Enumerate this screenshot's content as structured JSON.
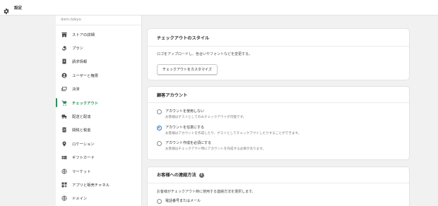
{
  "topbar": {
    "title": "設定",
    "icon": "gear-icon"
  },
  "sidebar": {
    "store_url": "dstn.tokyo",
    "items": [
      {
        "label": "ストアの詳細",
        "icon": "store-icon",
        "active": false
      },
      {
        "label": "プラン",
        "icon": "plan-icon",
        "active": false
      },
      {
        "label": "請求情報",
        "icon": "billing-icon",
        "active": false
      },
      {
        "label": "ユーザーと権限",
        "icon": "user-icon",
        "active": false
      },
      {
        "label": "決済",
        "icon": "payment-icon",
        "active": false
      },
      {
        "label": "チェックアウト",
        "icon": "cart-icon",
        "active": true
      },
      {
        "label": "配送と配達",
        "icon": "truck-icon",
        "active": false
      },
      {
        "label": "関税と税金",
        "icon": "tax-icon",
        "active": false
      },
      {
        "label": "ロケーション",
        "icon": "location-pin-icon",
        "active": false
      },
      {
        "label": "ギフトカード",
        "icon": "gift-card-icon",
        "active": false
      },
      {
        "label": "マーケット",
        "icon": "globe-icon",
        "active": false
      },
      {
        "label": "アプリと販売チャネル",
        "icon": "apps-icon",
        "active": false
      },
      {
        "label": "ドメイン",
        "icon": "domain-globe-icon",
        "active": false
      }
    ]
  },
  "checkout_style": {
    "title": "チェックアウトのスタイル",
    "description": "ロゴをアップロードし、色合いやフォントなどを変更する。",
    "button_label": "チェックアウトをカスタマイズ"
  },
  "customer_accounts": {
    "title": "顧客アカウント",
    "options": [
      {
        "label": "アカウントを使用しない",
        "help": "お客様はゲストとしてのみチェックアウトが可能です。",
        "checked": false
      },
      {
        "label": "アカウントを任意にする",
        "help": "お客様はアカウントを作成したり、ゲストとしてチェックアウトしたりすることができます。",
        "checked": true
      },
      {
        "label": "アカウント作成を必須にする",
        "help": "お客様はチェックアウト時にアカウントを作成する必要があります。",
        "checked": false
      }
    ]
  },
  "contact_method": {
    "title": "お客様への連絡方法",
    "info_icon": "info-icon",
    "description": "お客様がチェックアウト時に使用する連絡方法を選択します。",
    "options": [
      {
        "label": "電話番号またはメール",
        "checked": false
      }
    ]
  },
  "colors": {
    "accent_green": "#2e8a5e",
    "radio_blue": "#2c6ecb"
  }
}
